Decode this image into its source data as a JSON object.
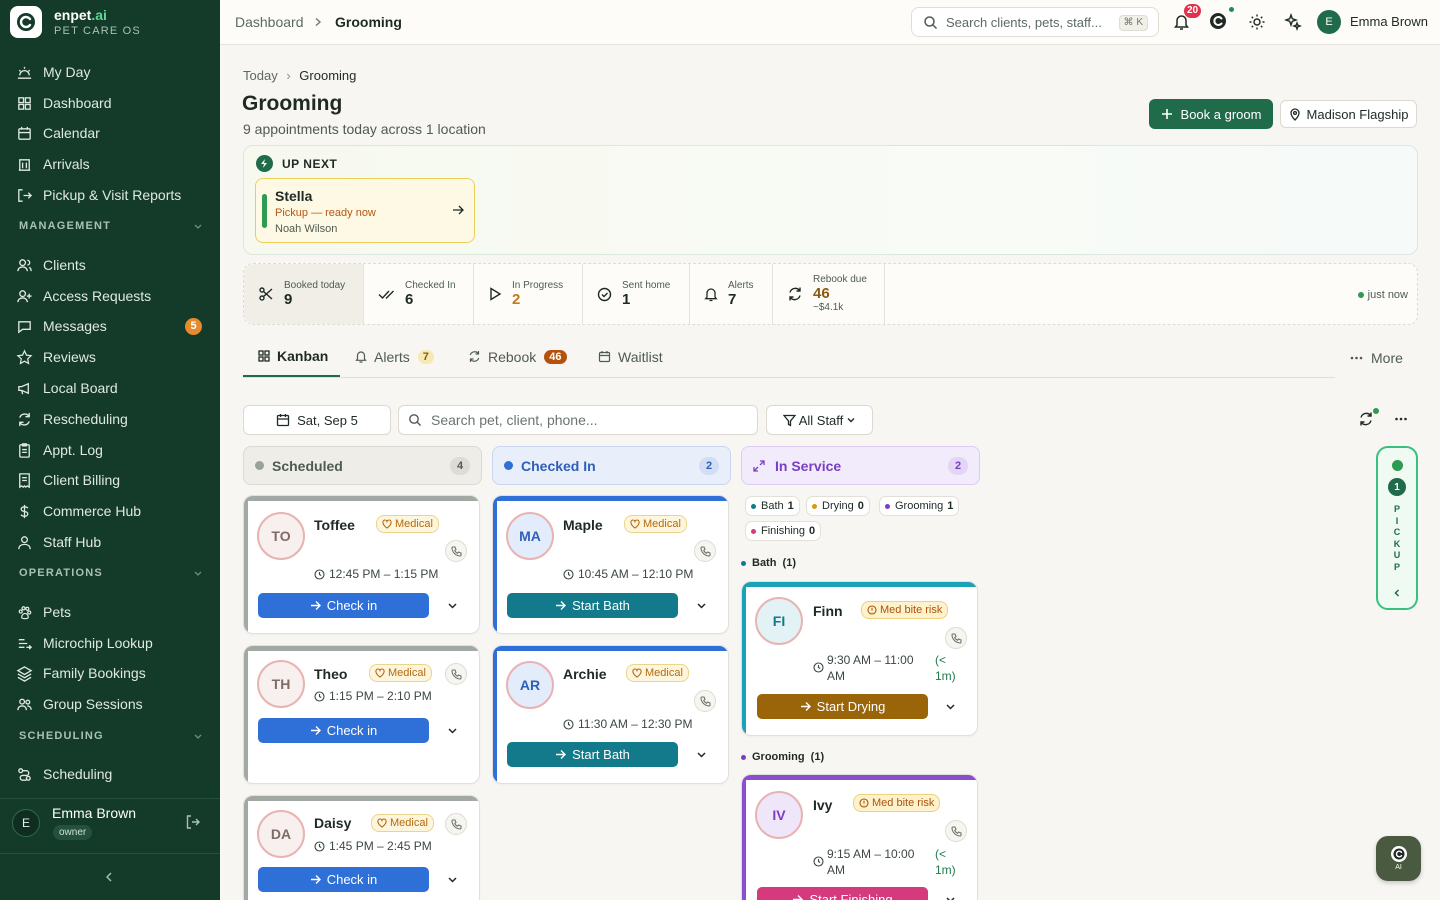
{
  "brand": {
    "name": "enpet",
    "name_suffix": ".ai",
    "subtitle": "PET CARE OS"
  },
  "sidebar": {
    "primary": [
      {
        "label": "My Day",
        "icon": "sun-horizon-icon"
      },
      {
        "label": "Dashboard",
        "icon": "grid-icon"
      },
      {
        "label": "Calendar",
        "icon": "calendar-icon"
      },
      {
        "label": "Arrivals",
        "icon": "building-icon"
      },
      {
        "label": "Pickup & Visit Reports",
        "icon": "exit-arrow-icon"
      }
    ],
    "sections": [
      {
        "title": "MANAGEMENT",
        "items": [
          {
            "label": "Clients",
            "icon": "users-icon"
          },
          {
            "label": "Access Requests",
            "icon": "user-plus-icon"
          },
          {
            "label": "Messages",
            "icon": "message-icon",
            "badge": "5"
          },
          {
            "label": "Reviews",
            "icon": "star-icon"
          },
          {
            "label": "Local Board",
            "icon": "megaphone-icon"
          },
          {
            "label": "Rescheduling",
            "icon": "refresh-icon"
          },
          {
            "label": "Appt. Log",
            "icon": "clipboard-icon"
          },
          {
            "label": "Client Billing",
            "icon": "receipt-icon"
          },
          {
            "label": "Commerce Hub",
            "icon": "dollar-icon"
          },
          {
            "label": "Staff Hub",
            "icon": "staff-icon"
          }
        ]
      },
      {
        "title": "OPERATIONS",
        "items": [
          {
            "label": "Pets",
            "icon": "paw-icon"
          },
          {
            "label": "Microchip Lookup",
            "icon": "chip-icon"
          },
          {
            "label": "Family Bookings",
            "icon": "layers-icon"
          },
          {
            "label": "Group Sessions",
            "icon": "group-icon"
          }
        ]
      },
      {
        "title": "SCHEDULING",
        "items": [
          {
            "label": "Scheduling",
            "icon": "route-icon"
          }
        ]
      }
    ],
    "user": {
      "initial": "E",
      "name": "Emma Brown",
      "role": "owner"
    }
  },
  "topbar": {
    "breadcrumb": [
      "Dashboard",
      "Grooming"
    ],
    "search_placeholder": "Search clients, pets, staff...",
    "shortcut": "⌘ K",
    "notification_count": "20",
    "user": {
      "initial": "E",
      "name": "Emma Brown"
    }
  },
  "page": {
    "breadcrumb": [
      "Today",
      "Grooming"
    ],
    "title": "Grooming",
    "subtitle": "9 appointments today across 1 location",
    "book_button": "Book a groom",
    "location_button": "Madison Flagship"
  },
  "up_next": {
    "heading": "UP NEXT",
    "pet": "Stella",
    "status": "Pickup — ready now",
    "client": "Noah Wilson"
  },
  "stats": {
    "items": [
      {
        "label": "Booked today",
        "value": "9",
        "icon": "scissors-icon"
      },
      {
        "label": "Checked In",
        "value": "6",
        "icon": "double-check-icon"
      },
      {
        "label": "In Progress",
        "value": "2",
        "icon": "play-icon"
      },
      {
        "label": "Sent home",
        "value": "1",
        "icon": "check-circle-icon"
      },
      {
        "label": "Alerts",
        "value": "7",
        "icon": "bell-icon"
      },
      {
        "label": "Rebook due",
        "value": "46",
        "sub": "~$4.1k",
        "icon": "refresh-icon"
      }
    ],
    "updated": "just now"
  },
  "tabs": {
    "kanban": "Kanban",
    "alerts": "Alerts",
    "alerts_count": "7",
    "rebook": "Rebook",
    "rebook_count": "46",
    "waitlist": "Waitlist",
    "more": "More"
  },
  "filters": {
    "date": "Sat, Sep 5",
    "search_placeholder": "Search pet, client, phone...",
    "staff": "All Staff"
  },
  "columns": {
    "scheduled": {
      "title": "Scheduled",
      "count": "4"
    },
    "checked_in": {
      "title": "Checked In",
      "count": "2"
    },
    "in_service": {
      "title": "In Service",
      "count": "2"
    }
  },
  "cards": {
    "toffee": {
      "initials": "TO",
      "name": "Toffee",
      "tag": "Medical",
      "time": "12:45 PM – 1:15 PM",
      "action": "Check in"
    },
    "theo": {
      "initials": "TH",
      "name": "Theo",
      "tag": "Medical",
      "time": "1:15 PM – 2:10 PM",
      "action": "Check in"
    },
    "daisy": {
      "initials": "DA",
      "name": "Daisy",
      "tag": "Medical",
      "time": "1:45 PM – 2:45 PM",
      "action": "Check in"
    },
    "maple": {
      "initials": "MA",
      "name": "Maple",
      "tag": "Medical",
      "time": "10:45 AM – 12:10 PM",
      "action": "Start Bath"
    },
    "archie": {
      "initials": "AR",
      "name": "Archie",
      "tag": "Medical",
      "time": "11:30 AM – 12:30 PM",
      "action": "Start Bath"
    },
    "finn": {
      "initials": "FI",
      "name": "Finn",
      "tag": "Med bite risk",
      "time_l1": "9:30 AM – 11:00",
      "time_l2": "AM",
      "since_l1": "(<",
      "since_l2": "1m)",
      "action": "Start Drying"
    },
    "ivy": {
      "initials": "IV",
      "name": "Ivy",
      "tag": "Med bite risk",
      "time_l1": "9:15 AM – 10:00",
      "time_l2": "AM",
      "since_l1": "(<",
      "since_l2": "1m)",
      "action": "Start Finishing"
    }
  },
  "stages": {
    "chips": [
      {
        "label": "Bath",
        "count": "1"
      },
      {
        "label": "Drying",
        "count": "0"
      },
      {
        "label": "Grooming",
        "count": "1"
      },
      {
        "label": "Finishing",
        "count": "0"
      }
    ],
    "bath_label": "Bath  (1)",
    "grooming_label": "Grooming  (1)"
  },
  "pickup_rail": {
    "count": "1",
    "letters": [
      "P",
      "I",
      "C",
      "K",
      "U",
      "P"
    ]
  },
  "ai_button": {
    "label": "AI"
  },
  "colors": {
    "sidebar_bg": "#143a2a",
    "primary": "#1f6b4a",
    "check_in_blue": "#2f6fd8",
    "bath_teal": "#127a8a",
    "drying_brown": "#9a6408",
    "finishing_pink": "#d43a7c",
    "in_service_purple": "#7a3fc0"
  }
}
